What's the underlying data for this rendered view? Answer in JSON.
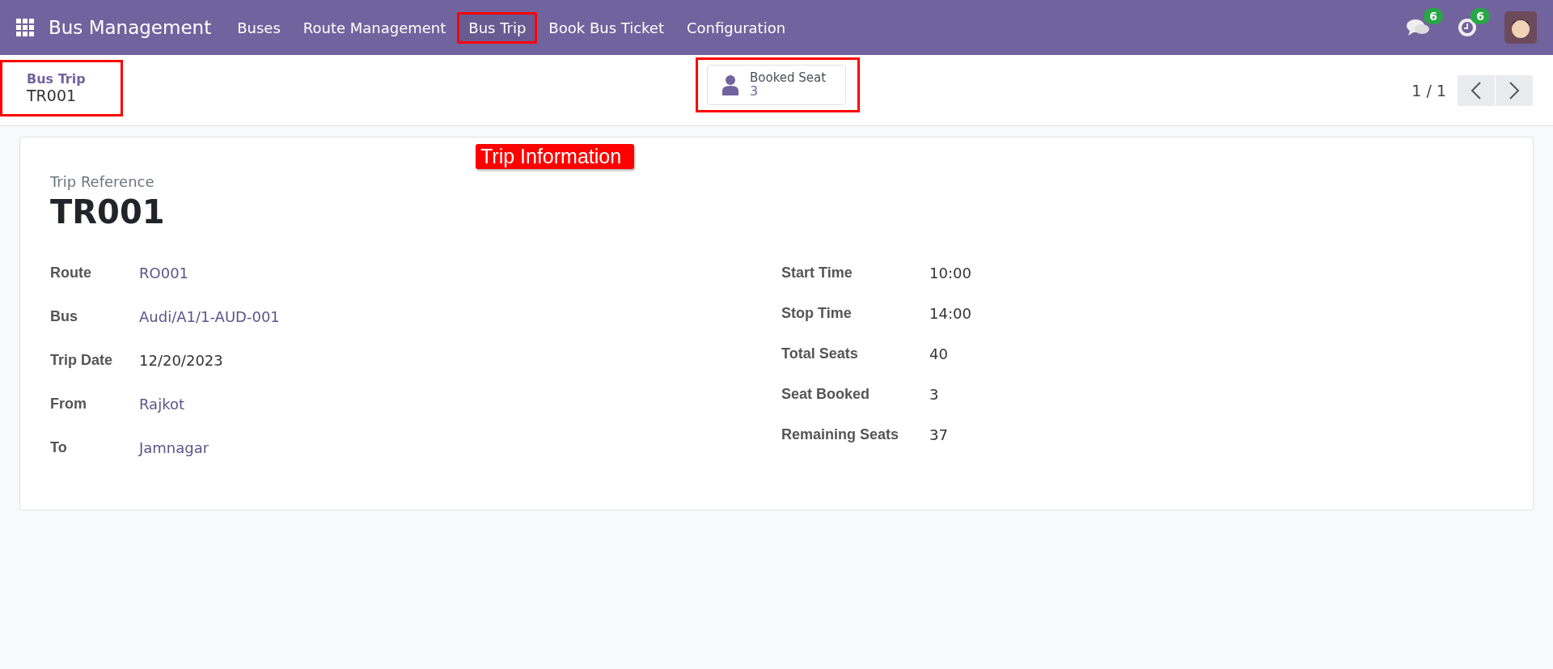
{
  "navbar": {
    "app_name": "Bus Management",
    "menu": [
      {
        "label": "Buses",
        "selected": false,
        "highlighted": false
      },
      {
        "label": "Route Management",
        "selected": false,
        "highlighted": false
      },
      {
        "label": "Bus Trip",
        "selected": true,
        "highlighted": true
      },
      {
        "label": "Book Bus Ticket",
        "selected": false,
        "highlighted": false
      },
      {
        "label": "Configuration",
        "selected": false,
        "highlighted": false
      }
    ],
    "messages_count": "6",
    "activities_count": "6"
  },
  "breadcrumb": {
    "parent": "Bus Trip",
    "current": "TR001",
    "highlighted": true
  },
  "smart_button": {
    "label": "Booked Seat",
    "value": "3",
    "highlighted": true
  },
  "pager": {
    "text": "1 / 1"
  },
  "callout": "Trip Information",
  "form": {
    "reference_label": "Trip Reference",
    "reference": "TR001",
    "left_fields": [
      {
        "label": "Route",
        "value": "RO001",
        "kind": "link"
      },
      {
        "label": "Bus",
        "value": "Audi/A1/1-AUD-001",
        "kind": "link"
      },
      {
        "label": "Trip Date",
        "value": "12/20/2023",
        "kind": "text"
      },
      {
        "label": "From",
        "value": "Rajkot",
        "kind": "link"
      },
      {
        "label": "To",
        "value": "Jamnagar",
        "kind": "link"
      }
    ],
    "right_fields": [
      {
        "label": "Start Time",
        "value": "10:00"
      },
      {
        "label": "Stop Time",
        "value": "14:00"
      },
      {
        "label": "Total Seats",
        "value": "40"
      },
      {
        "label": "Seat Booked",
        "value": "3"
      },
      {
        "label": "Remaining Seats",
        "value": "37"
      }
    ]
  }
}
